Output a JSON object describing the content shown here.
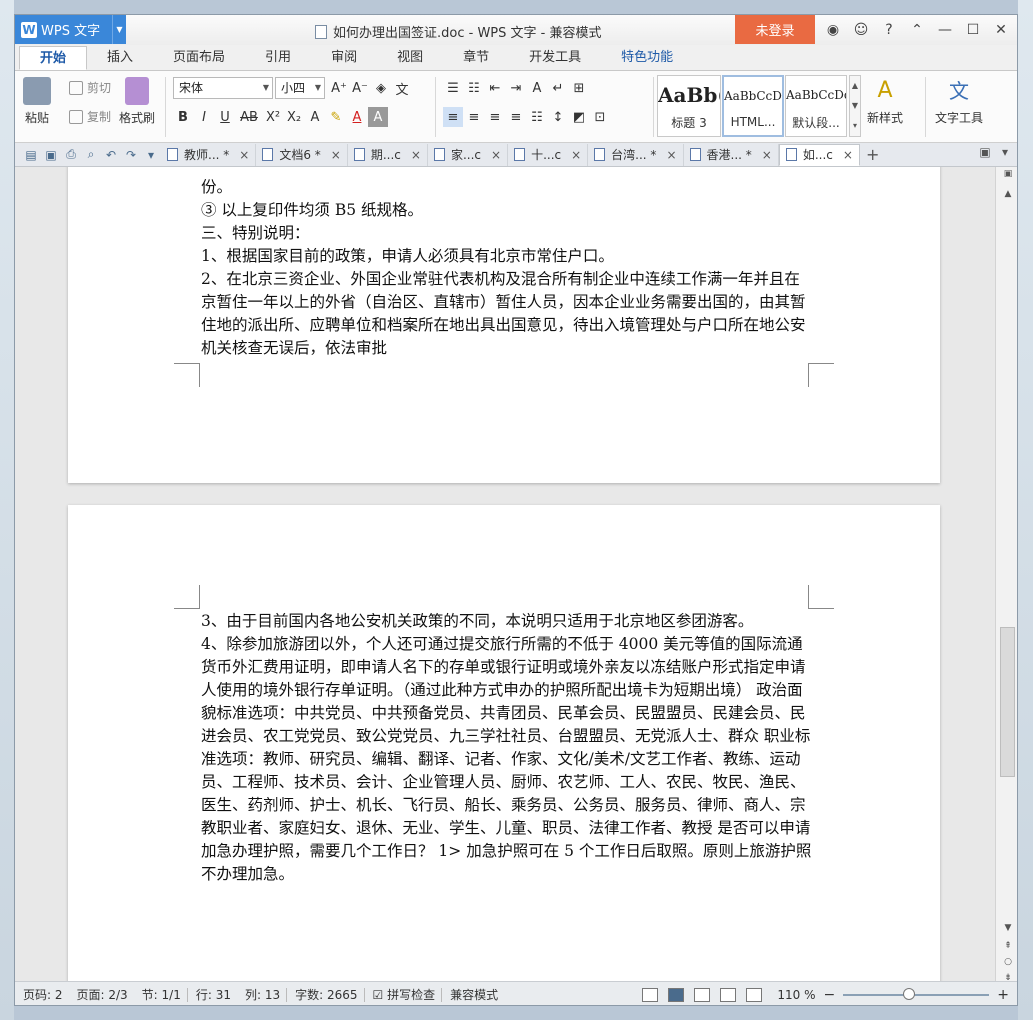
{
  "app": {
    "name": "WPS 文字",
    "window_title": "如何办理出国签证.doc - WPS 文字 - 兼容模式",
    "login_label": "未登录",
    "help": "?"
  },
  "ribbon_tabs": [
    "开始",
    "插入",
    "页面布局",
    "引用",
    "审阅",
    "视图",
    "章节",
    "开发工具",
    "特色功能"
  ],
  "toolbar": {
    "paste": "粘贴",
    "cut": "剪切",
    "copy": "复制",
    "format_painter": "格式刷",
    "font_name": "宋体",
    "font_size": "小四",
    "styles": [
      {
        "sample": "AaBb(",
        "label": "标题 3"
      },
      {
        "sample": "AaBbCcDd",
        "label": "HTML..."
      },
      {
        "sample": "AaBbCcDd",
        "label": "默认段..."
      }
    ],
    "new_style": "新样式",
    "text_tools": "文字工具"
  },
  "doc_tabs": [
    {
      "label": "教师... *",
      "active": false
    },
    {
      "label": "文档6 *",
      "active": false
    },
    {
      "label": "期...c",
      "active": false
    },
    {
      "label": "家...c",
      "active": false
    },
    {
      "label": "十...c",
      "active": false
    },
    {
      "label": "台湾... *",
      "active": false
    },
    {
      "label": "香港... *",
      "active": false
    },
    {
      "label": "如...c",
      "active": true
    }
  ],
  "page1_lines": [
    "份。",
    "③ 以上复印件均须 B5 纸规格。",
    "三、特别说明：",
    "1、根据国家目前的政策，申请人必须具有北京市常住户口。",
    "2、在北京三资企业、外国企业常驻代表机构及混合所有制企业中连续工作满一年并且在京暂住一年以上的外省（自治区、直辖市）暂住人员，因本企业业务需要出国的，由其暂住地的派出所、应聘单位和档案所在地出具出国意见，待出入境管理处与户口所在地公安机关核查无误后，依法审批"
  ],
  "page2_lines": [
    "3、由于目前国内各地公安机关政策的不同，本说明只适用于北京地区参团游客。",
    "4、除参加旅游团以外，个人还可通过提交旅行所需的不低于 4000 美元等值的国际流通货币外汇费用证明，即申请人名下的存单或银行证明或境外亲友以冻结账户形式指定申请人使用的境外银行存单证明。（通过此种方式申办的护照所配出境卡为短期出境） 政治面貌标准选项：中共党员、中共预备党员、共青团员、民革会员、民盟盟员、民建会员、民进会员、农工党党员、致公党党员、九三学社社员、台盟盟员、无党派人士、群众 职业标准选项：教师、研究员、编辑、翻译、记者、作家、文化/美术/文艺工作者、教练、运动员、工程师、技术员、会计、企业管理人员、厨师、农艺师、工人、农民、牧民、渔民、医生、药剂师、护士、机长、飞行员、船长、乘务员、公务员、服务员、律师、商人、宗教职业者、家庭妇女、退休、无业、学生、儿童、职员、法律工作者、教授 是否可以申请加急办理护照，需要几个工作日？ 1> 加急护照可在 5 个工作日后取照。原则上旅游护照不办理加急。"
  ],
  "status": {
    "page_no": "页码: 2",
    "pages": "页面: 2/3",
    "section": "节: 1/1",
    "row": "行: 31",
    "col": "列: 13",
    "word_count": "字数: 2665",
    "spell_check": "拼写检查",
    "compat_mode": "兼容模式",
    "zoom": "110 %",
    "zoom_fraction": 0.45
  },
  "colors": {
    "accent": "#3a87d9",
    "login": "#e96a42"
  }
}
